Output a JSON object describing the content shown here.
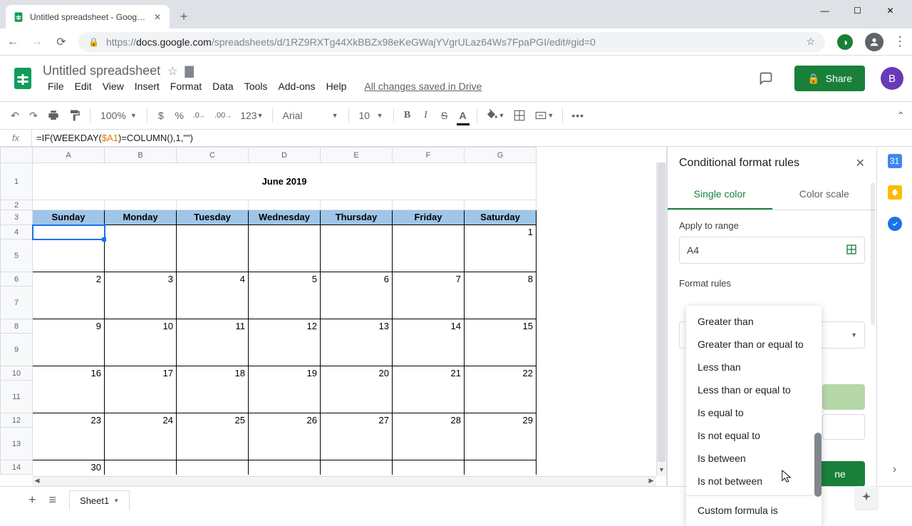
{
  "browser": {
    "tab_title": "Untitled spreadsheet - Google S",
    "url_secure": "https://",
    "url_host": "docs.google.com",
    "url_path": "/spreadsheets/d/1RZ9RXTg44XkBBZx98eKeGWajYVgrULaz64Ws7FpaPGI/edit#gid=0"
  },
  "doc": {
    "name": "Untitled spreadsheet",
    "saved_status": "All changes saved in Drive",
    "profile_letter": "B",
    "share_label": "Share"
  },
  "menu": {
    "file": "File",
    "edit": "Edit",
    "view": "View",
    "insert": "Insert",
    "format": "Format",
    "data": "Data",
    "tools": "Tools",
    "addons": "Add-ons",
    "help": "Help"
  },
  "toolbar": {
    "zoom": "100%",
    "currency": "$",
    "percent": "%",
    "dec_dec": ".0",
    "inc_dec": ".00",
    "numfmt": "123",
    "font": "Arial",
    "size": "10"
  },
  "formula": {
    "prefix": "=IF(WEEKDAY(",
    "ref": "$A1",
    "suffix": ")=COLUMN(),1,\"\")"
  },
  "calendar": {
    "title": "June 2019",
    "days": [
      "Sunday",
      "Monday",
      "Tuesday",
      "Wednesday",
      "Thursday",
      "Friday",
      "Saturday"
    ],
    "rows": [
      [
        "",
        "",
        "",
        "",
        "",
        "",
        "1"
      ],
      [
        "2",
        "3",
        "4",
        "5",
        "6",
        "7",
        "8"
      ],
      [
        "9",
        "10",
        "11",
        "12",
        "13",
        "14",
        "15"
      ],
      [
        "16",
        "17",
        "18",
        "19",
        "20",
        "21",
        "22"
      ],
      [
        "23",
        "24",
        "25",
        "26",
        "27",
        "28",
        "29"
      ],
      [
        "30",
        "",
        "",
        "",
        "",
        "",
        ""
      ]
    ]
  },
  "columns": [
    "A",
    "B",
    "C",
    "D",
    "E",
    "F",
    "G"
  ],
  "row_numbers": [
    "1",
    "2",
    "3",
    "4",
    "5",
    "6",
    "7",
    "8",
    "9",
    "10",
    "11",
    "12",
    "13",
    "14"
  ],
  "sidebar": {
    "title": "Conditional format rules",
    "tab_single": "Single color",
    "tab_scale": "Color scale",
    "apply_label": "Apply to range",
    "range": "A4",
    "rules_label": "Format rules",
    "done": "ne",
    "options": [
      "Greater than",
      "Greater than or equal to",
      "Less than",
      "Less than or equal to",
      "Is equal to",
      "Is not equal to",
      "Is between",
      "Is not between",
      "Custom formula is"
    ]
  },
  "sheet_tab": "Sheet1"
}
